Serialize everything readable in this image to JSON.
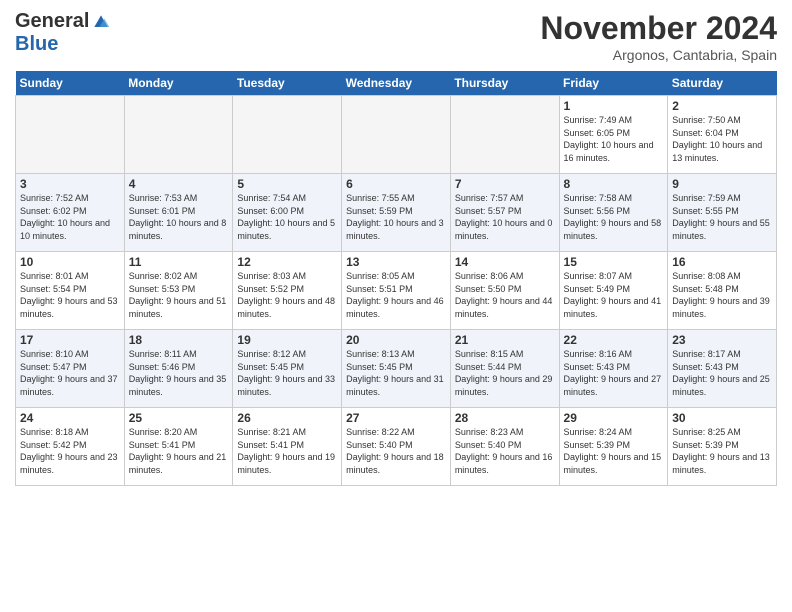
{
  "header": {
    "logo_general": "General",
    "logo_blue": "Blue",
    "month_title": "November 2024",
    "location": "Argonos, Cantabria, Spain"
  },
  "days_of_week": [
    "Sunday",
    "Monday",
    "Tuesday",
    "Wednesday",
    "Thursday",
    "Friday",
    "Saturday"
  ],
  "weeks": [
    {
      "days": [
        {
          "num": "",
          "info": "",
          "empty": true
        },
        {
          "num": "",
          "info": "",
          "empty": true
        },
        {
          "num": "",
          "info": "",
          "empty": true
        },
        {
          "num": "",
          "info": "",
          "empty": true
        },
        {
          "num": "",
          "info": "",
          "empty": true
        },
        {
          "num": "1",
          "info": "Sunrise: 7:49 AM\nSunset: 6:05 PM\nDaylight: 10 hours and 16 minutes."
        },
        {
          "num": "2",
          "info": "Sunrise: 7:50 AM\nSunset: 6:04 PM\nDaylight: 10 hours and 13 minutes."
        }
      ]
    },
    {
      "days": [
        {
          "num": "3",
          "info": "Sunrise: 7:52 AM\nSunset: 6:02 PM\nDaylight: 10 hours and 10 minutes."
        },
        {
          "num": "4",
          "info": "Sunrise: 7:53 AM\nSunset: 6:01 PM\nDaylight: 10 hours and 8 minutes."
        },
        {
          "num": "5",
          "info": "Sunrise: 7:54 AM\nSunset: 6:00 PM\nDaylight: 10 hours and 5 minutes."
        },
        {
          "num": "6",
          "info": "Sunrise: 7:55 AM\nSunset: 5:59 PM\nDaylight: 10 hours and 3 minutes."
        },
        {
          "num": "7",
          "info": "Sunrise: 7:57 AM\nSunset: 5:57 PM\nDaylight: 10 hours and 0 minutes."
        },
        {
          "num": "8",
          "info": "Sunrise: 7:58 AM\nSunset: 5:56 PM\nDaylight: 9 hours and 58 minutes."
        },
        {
          "num": "9",
          "info": "Sunrise: 7:59 AM\nSunset: 5:55 PM\nDaylight: 9 hours and 55 minutes."
        }
      ]
    },
    {
      "days": [
        {
          "num": "10",
          "info": "Sunrise: 8:01 AM\nSunset: 5:54 PM\nDaylight: 9 hours and 53 minutes."
        },
        {
          "num": "11",
          "info": "Sunrise: 8:02 AM\nSunset: 5:53 PM\nDaylight: 9 hours and 51 minutes."
        },
        {
          "num": "12",
          "info": "Sunrise: 8:03 AM\nSunset: 5:52 PM\nDaylight: 9 hours and 48 minutes."
        },
        {
          "num": "13",
          "info": "Sunrise: 8:05 AM\nSunset: 5:51 PM\nDaylight: 9 hours and 46 minutes."
        },
        {
          "num": "14",
          "info": "Sunrise: 8:06 AM\nSunset: 5:50 PM\nDaylight: 9 hours and 44 minutes."
        },
        {
          "num": "15",
          "info": "Sunrise: 8:07 AM\nSunset: 5:49 PM\nDaylight: 9 hours and 41 minutes."
        },
        {
          "num": "16",
          "info": "Sunrise: 8:08 AM\nSunset: 5:48 PM\nDaylight: 9 hours and 39 minutes."
        }
      ]
    },
    {
      "days": [
        {
          "num": "17",
          "info": "Sunrise: 8:10 AM\nSunset: 5:47 PM\nDaylight: 9 hours and 37 minutes."
        },
        {
          "num": "18",
          "info": "Sunrise: 8:11 AM\nSunset: 5:46 PM\nDaylight: 9 hours and 35 minutes."
        },
        {
          "num": "19",
          "info": "Sunrise: 8:12 AM\nSunset: 5:45 PM\nDaylight: 9 hours and 33 minutes."
        },
        {
          "num": "20",
          "info": "Sunrise: 8:13 AM\nSunset: 5:45 PM\nDaylight: 9 hours and 31 minutes."
        },
        {
          "num": "21",
          "info": "Sunrise: 8:15 AM\nSunset: 5:44 PM\nDaylight: 9 hours and 29 minutes."
        },
        {
          "num": "22",
          "info": "Sunrise: 8:16 AM\nSunset: 5:43 PM\nDaylight: 9 hours and 27 minutes."
        },
        {
          "num": "23",
          "info": "Sunrise: 8:17 AM\nSunset: 5:43 PM\nDaylight: 9 hours and 25 minutes."
        }
      ]
    },
    {
      "days": [
        {
          "num": "24",
          "info": "Sunrise: 8:18 AM\nSunset: 5:42 PM\nDaylight: 9 hours and 23 minutes."
        },
        {
          "num": "25",
          "info": "Sunrise: 8:20 AM\nSunset: 5:41 PM\nDaylight: 9 hours and 21 minutes."
        },
        {
          "num": "26",
          "info": "Sunrise: 8:21 AM\nSunset: 5:41 PM\nDaylight: 9 hours and 19 minutes."
        },
        {
          "num": "27",
          "info": "Sunrise: 8:22 AM\nSunset: 5:40 PM\nDaylight: 9 hours and 18 minutes."
        },
        {
          "num": "28",
          "info": "Sunrise: 8:23 AM\nSunset: 5:40 PM\nDaylight: 9 hours and 16 minutes."
        },
        {
          "num": "29",
          "info": "Sunrise: 8:24 AM\nSunset: 5:39 PM\nDaylight: 9 hours and 15 minutes."
        },
        {
          "num": "30",
          "info": "Sunrise: 8:25 AM\nSunset: 5:39 PM\nDaylight: 9 hours and 13 minutes."
        }
      ]
    }
  ]
}
